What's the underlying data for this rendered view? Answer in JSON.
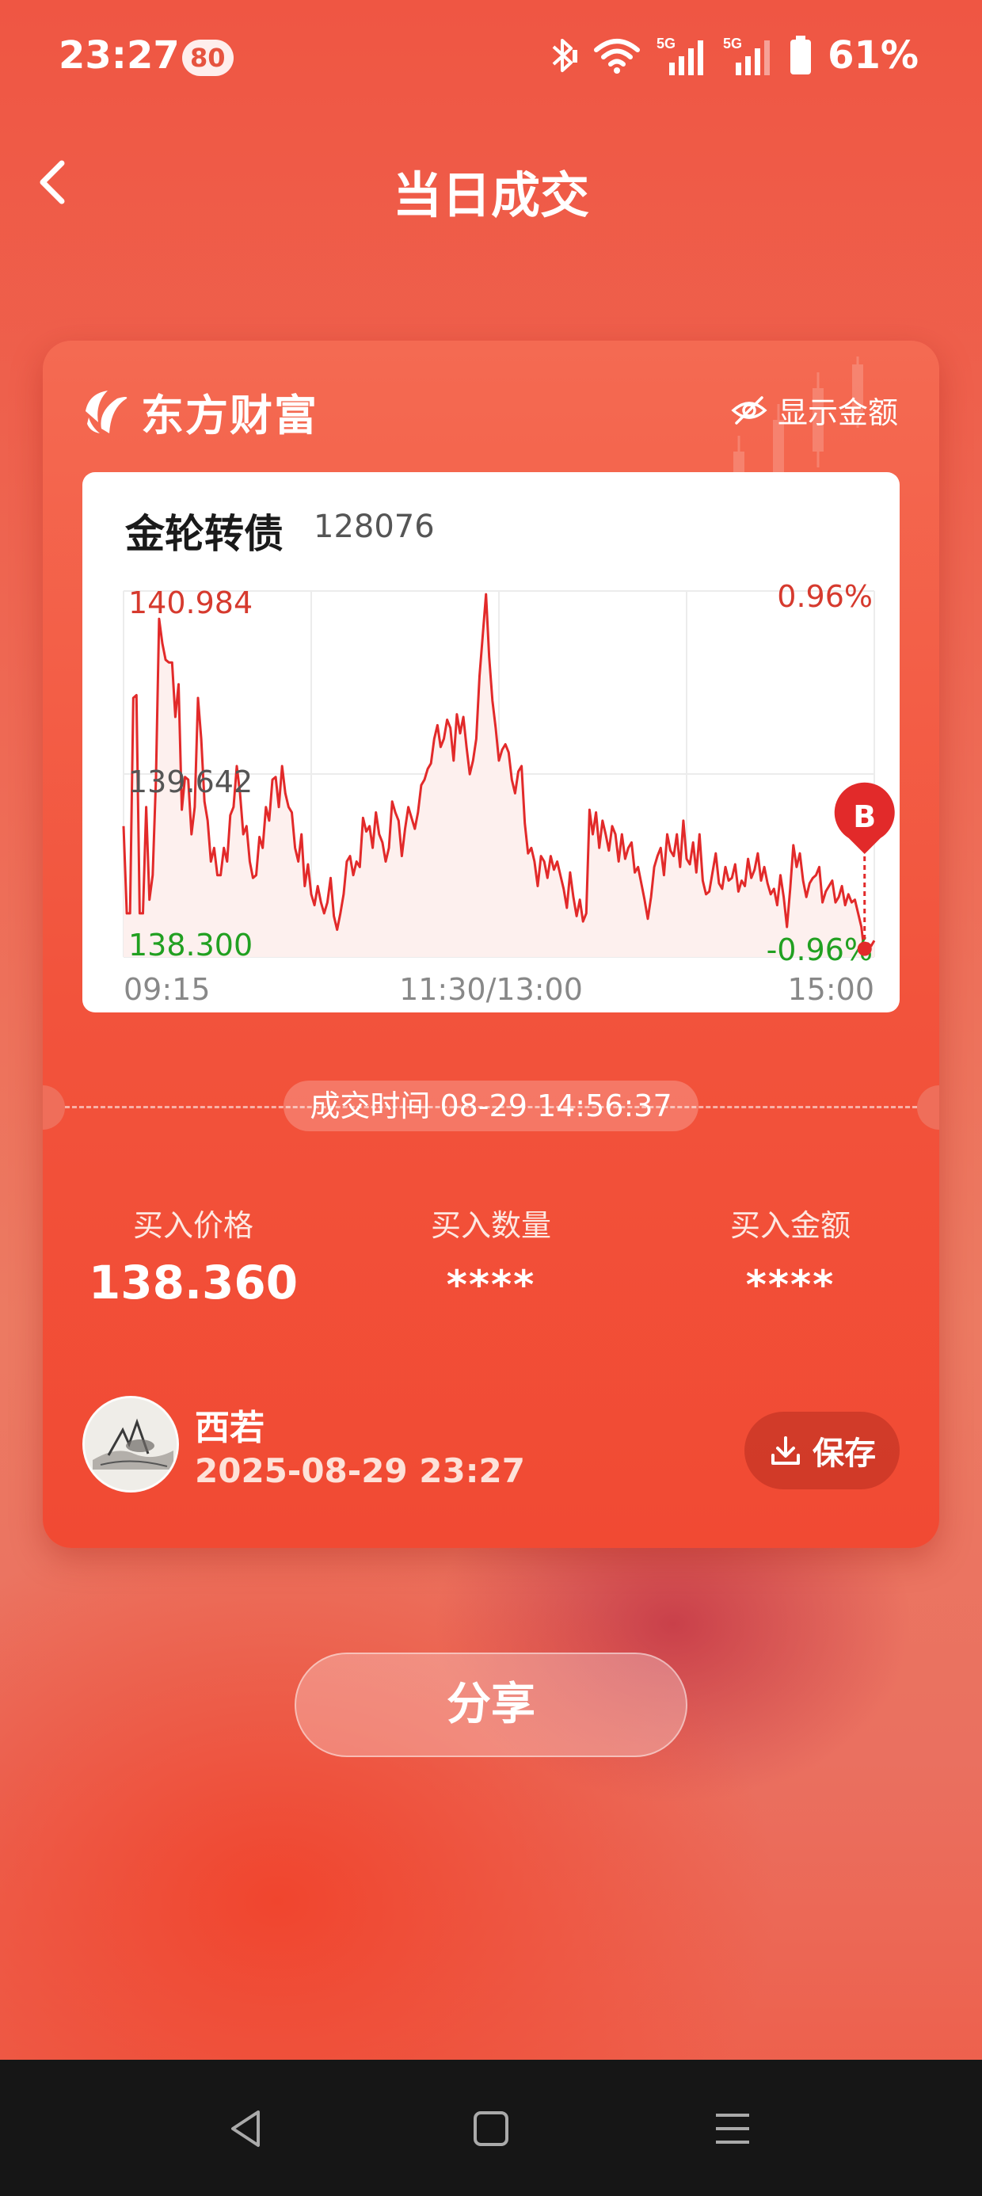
{
  "status_bar": {
    "time": "23:27",
    "badge": "80",
    "battery": "61%",
    "network": "5G"
  },
  "header": {
    "title": "当日成交",
    "back_icon": "chevron-left-icon"
  },
  "card": {
    "brand": "东方财富",
    "show_amount_label": "显示金额",
    "stock": {
      "name": "金轮转债",
      "code": "128076"
    },
    "chart_data": {
      "type": "line",
      "y_labels": {
        "high": "140.984",
        "mid": "139.642",
        "low": "138.300"
      },
      "pct_labels": {
        "high": "0.96%",
        "low": "-0.96%"
      },
      "x_ticks": [
        "09:15",
        "11:30/13:00",
        "15:00"
      ],
      "ylim": [
        138.3,
        140.984
      ],
      "marker": {
        "label": "B",
        "time": "14:56",
        "price": 138.36
      },
      "colors": {
        "line": "#e22a2a",
        "up": "#d63a2e",
        "down": "#21a021",
        "fill": "#fdf0ee"
      },
      "series": [
        {
          "values": [
            139.26,
            138.62,
            138.62,
            140.2,
            140.22,
            138.62,
            138.62,
            139.4,
            138.72,
            138.9,
            139.6,
            140.78,
            140.6,
            140.48,
            140.46,
            140.46,
            140.06,
            140.3,
            139.38,
            139.62,
            139.6,
            139.2,
            139.4,
            140.2,
            139.9,
            139.44,
            139.3,
            139.0,
            139.1,
            138.9,
            138.9,
            139.1,
            139.0,
            139.34,
            139.4,
            139.7,
            139.5,
            139.2,
            139.26,
            139.0,
            138.88,
            138.9,
            139.18,
            139.1,
            139.4,
            139.3,
            139.6,
            139.62,
            139.4,
            139.7,
            139.5,
            139.4,
            139.36,
            139.1,
            139.0,
            139.2,
            138.82,
            138.98,
            138.76,
            138.68,
            138.82,
            138.7,
            138.62,
            138.7,
            138.88,
            138.6,
            138.5,
            138.62,
            138.76,
            139.0,
            139.04,
            138.9,
            139.0,
            138.96,
            139.32,
            139.22,
            139.26,
            139.1,
            139.36,
            139.2,
            139.14,
            139.0,
            139.1,
            139.44,
            139.36,
            139.3,
            139.04,
            139.24,
            139.4,
            139.32,
            139.24,
            139.36,
            139.56,
            139.6,
            139.68,
            139.72,
            139.9,
            140.0,
            139.84,
            139.9,
            140.04,
            139.98,
            139.74,
            140.08,
            139.94,
            140.06,
            139.84,
            139.64,
            139.74,
            139.9,
            140.36,
            140.66,
            140.96,
            140.5,
            140.18,
            139.98,
            139.74,
            139.82,
            139.86,
            139.8,
            139.6,
            139.5,
            139.66,
            139.7,
            139.28,
            139.06,
            139.1,
            139.0,
            138.82,
            139.04,
            139.0,
            138.88,
            139.04,
            138.94,
            139.0,
            138.9,
            138.8,
            138.66,
            138.92,
            138.74,
            138.6,
            138.72,
            138.56,
            138.62,
            139.38,
            139.2,
            139.36,
            139.1,
            139.3,
            139.2,
            139.08,
            139.26,
            139.2,
            139.0,
            139.2,
            139.02,
            139.1,
            139.14,
            138.92,
            138.96,
            138.84,
            138.72,
            138.58,
            138.74,
            138.96,
            139.04,
            139.1,
            138.9,
            139.2,
            139.08,
            139.04,
            139.2,
            138.96,
            139.3,
            139.02,
            138.98,
            139.14,
            138.92,
            139.2,
            138.86,
            138.76,
            138.78,
            138.92,
            139.06,
            138.84,
            138.8,
            138.96,
            138.86,
            138.88,
            138.98,
            138.78,
            138.86,
            138.82,
            139.02,
            138.88,
            138.94,
            139.06,
            138.86,
            138.96,
            138.84,
            138.76,
            138.8,
            138.68,
            138.9,
            138.74,
            138.52,
            138.8,
            139.12,
            138.96,
            139.06,
            138.86,
            138.74,
            138.84,
            138.88,
            138.9,
            138.96,
            138.7,
            138.78,
            138.82,
            138.86,
            138.7,
            138.74,
            138.82,
            138.68,
            138.76,
            138.7,
            138.72,
            138.62,
            138.52,
            138.32,
            138.4,
            138.38,
            138.42
          ]
        }
      ]
    },
    "trade_time": "成交时间 08-29 14:56:37",
    "metrics": [
      {
        "label": "买入价格",
        "value": "138.360"
      },
      {
        "label": "买入数量",
        "value": "****"
      },
      {
        "label": "买入金额",
        "value": "****"
      }
    ],
    "user": {
      "name": "西若",
      "datetime": "2025-08-29 23:27"
    },
    "save_label": "保存"
  },
  "share_label": "分享"
}
